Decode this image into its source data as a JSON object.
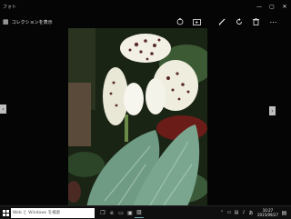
{
  "window": {
    "title": "フォト"
  },
  "toolbar": {
    "back_link": "コレクションを表示",
    "icons": [
      "share-icon",
      "slideshow-icon",
      "edit-icon",
      "rotate-icon",
      "delete-icon",
      "more-icon"
    ]
  },
  "taskbar": {
    "search_placeholder": "Web と Windows を検索",
    "time": "10:27",
    "date": "2015/09/27",
    "ime": "あ"
  },
  "colors": {
    "background": "#050505",
    "taskbar": "#0f0f0f",
    "accent": "#7aa9bb"
  }
}
